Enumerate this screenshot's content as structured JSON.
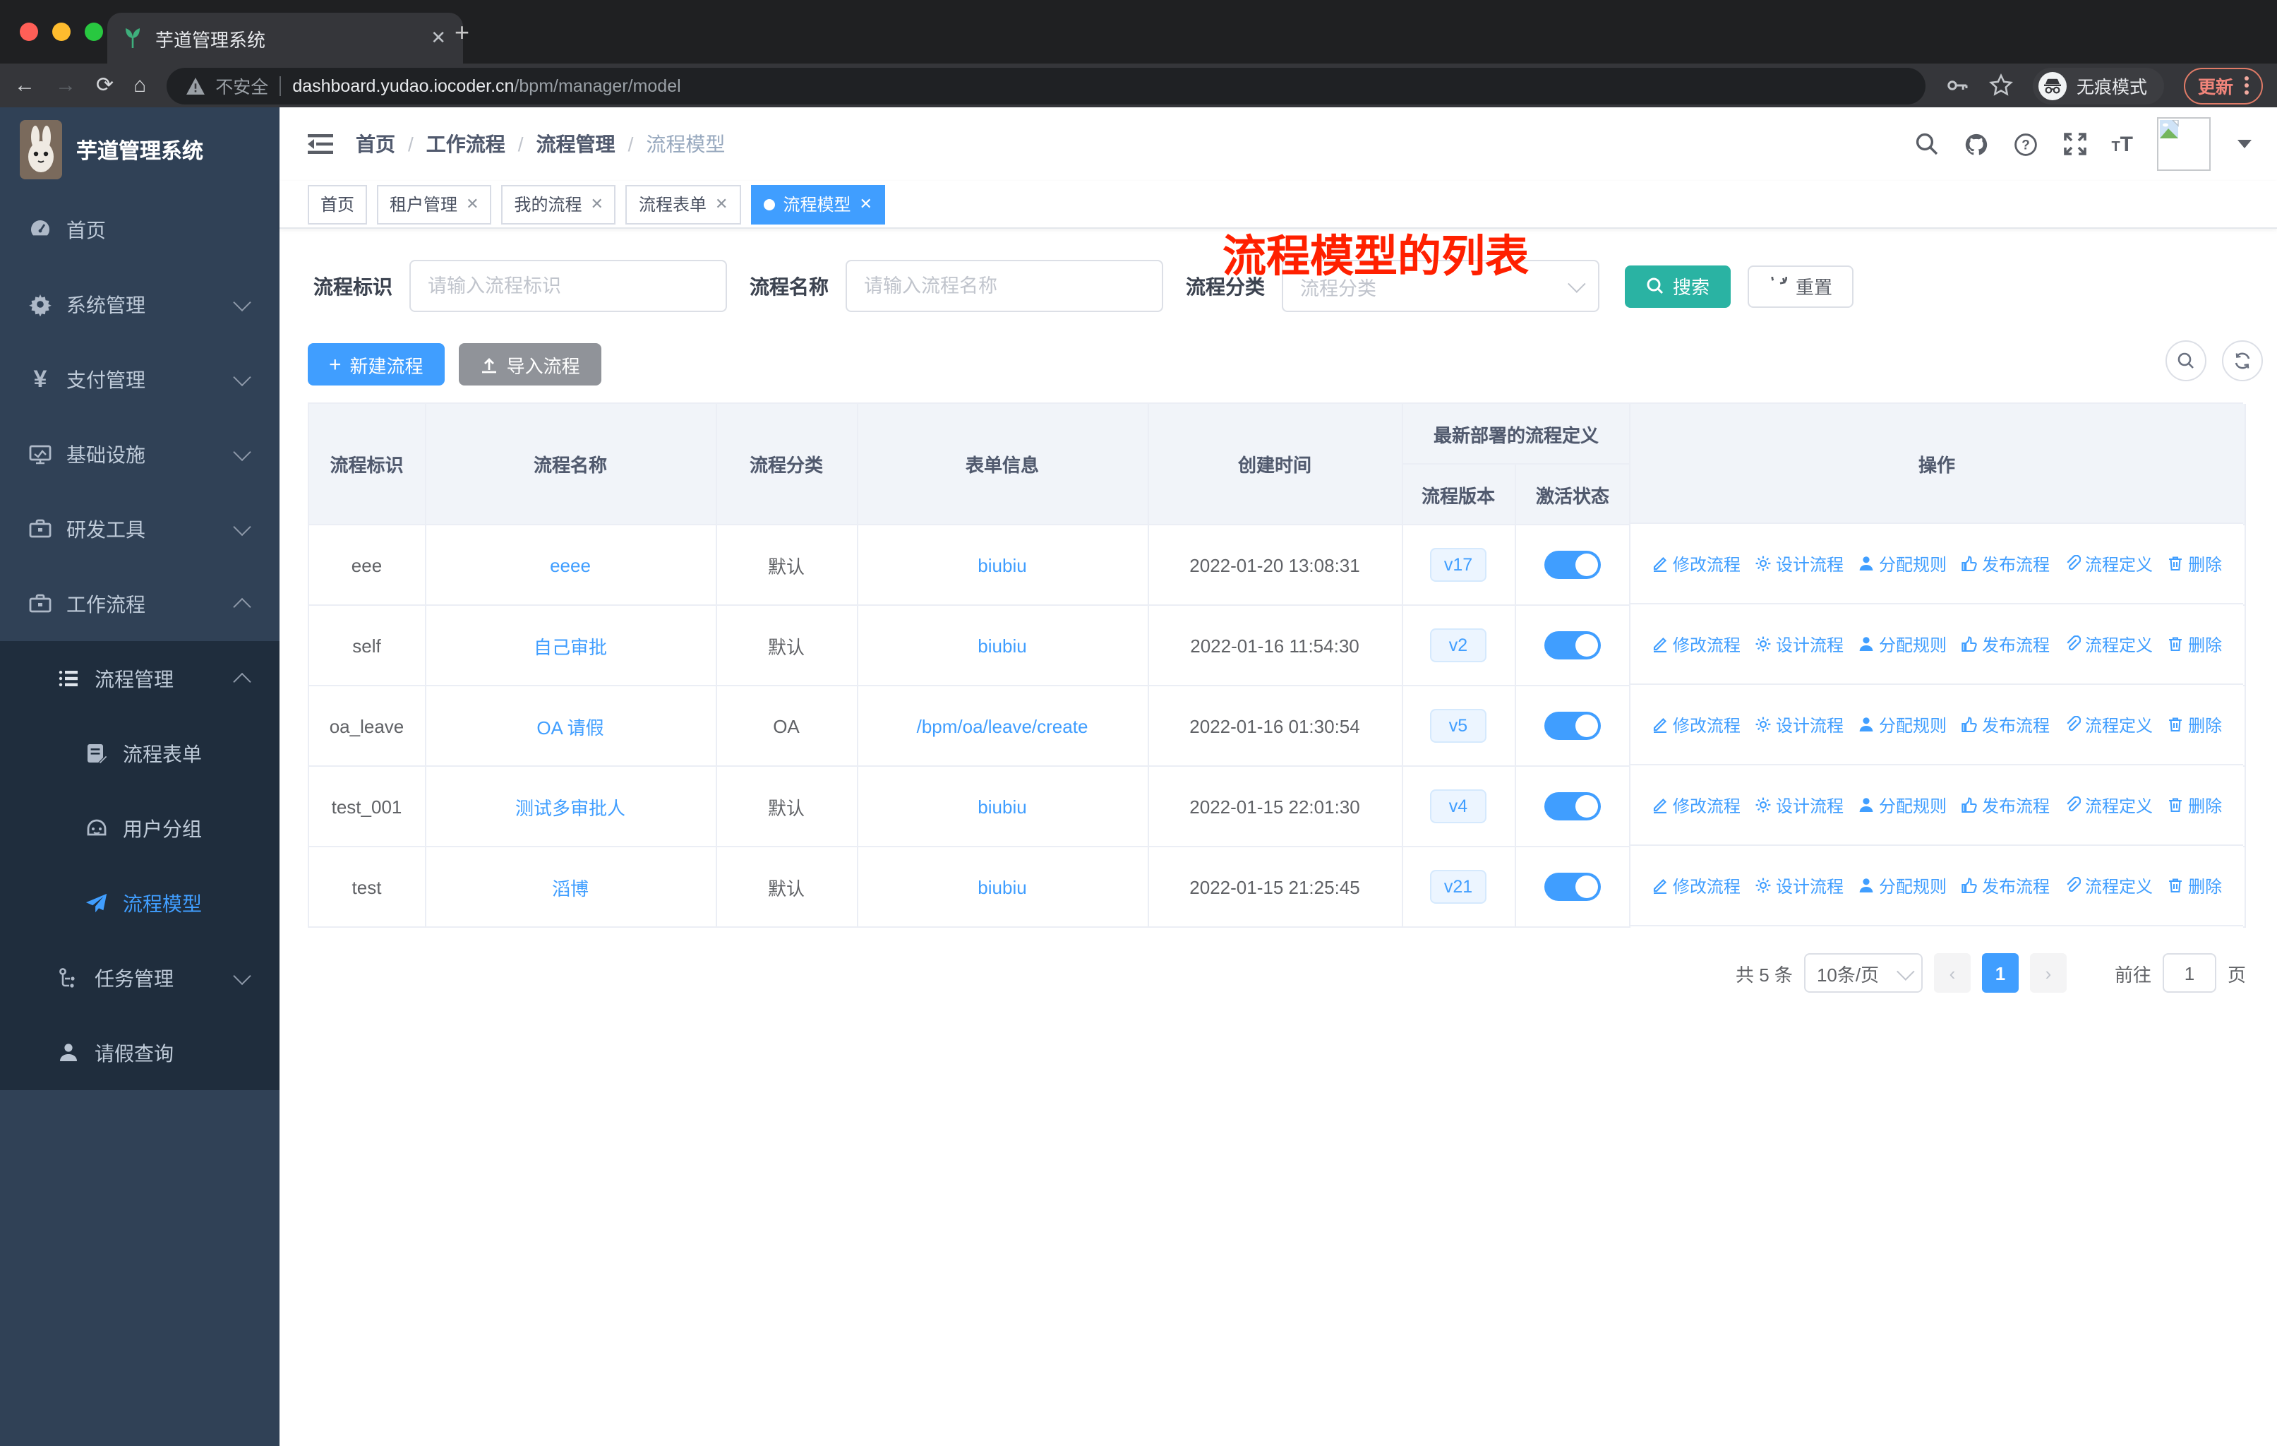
{
  "browser": {
    "tab_title": "芋道管理系统",
    "url_warning": "不安全",
    "url_host": "dashboard.yudao.iocoder.cn",
    "url_path": "/bpm/manager/model",
    "incognito_label": "无痕模式",
    "update_label": "更新"
  },
  "sidebar": {
    "logo_title": "芋道管理系统",
    "items": [
      {
        "label": "首页",
        "icon": "dashboard-icon"
      },
      {
        "label": "系统管理",
        "icon": "gear-icon",
        "arrow": "down"
      },
      {
        "label": "支付管理",
        "icon": "yen-icon",
        "arrow": "down"
      },
      {
        "label": "基础设施",
        "icon": "monitor-icon",
        "arrow": "down"
      },
      {
        "label": "研发工具",
        "icon": "toolbox-icon",
        "arrow": "down"
      },
      {
        "label": "工作流程",
        "icon": "briefcase-icon",
        "arrow": "up"
      },
      {
        "label": "流程管理",
        "icon": "list-icon",
        "arrow": "up"
      },
      {
        "label": "流程表单",
        "icon": "form-icon"
      },
      {
        "label": "用户分组",
        "icon": "robot-icon"
      },
      {
        "label": "流程模型",
        "icon": "paper-plane-icon",
        "active": true
      },
      {
        "label": "任务管理",
        "icon": "tree-icon",
        "arrow": "down"
      },
      {
        "label": "请假查询",
        "icon": "person-icon"
      }
    ]
  },
  "header": {
    "breadcrumb": [
      "首页",
      "工作流程",
      "流程管理",
      "流程模型"
    ],
    "annotation": "流程模型的列表"
  },
  "tags": [
    {
      "label": "首页"
    },
    {
      "label": "租户管理"
    },
    {
      "label": "我的流程"
    },
    {
      "label": "流程表单"
    },
    {
      "label": "流程模型",
      "active": true
    }
  ],
  "filters": {
    "id_label": "流程标识",
    "id_placeholder": "请输入流程标识",
    "name_label": "流程名称",
    "name_placeholder": "请输入流程名称",
    "category_label": "流程分类",
    "category_placeholder": "流程分类",
    "search_label": "搜索",
    "reset_label": "重置"
  },
  "toolbar": {
    "create_label": "新建流程",
    "import_label": "导入流程"
  },
  "table": {
    "headers": {
      "id": "流程标识",
      "name": "流程名称",
      "category": "流程分类",
      "form": "表单信息",
      "created": "创建时间",
      "deploy_group": "最新部署的流程定义",
      "version": "流程版本",
      "status": "激活状态",
      "ops": "操作"
    },
    "rows": [
      {
        "id": "eee",
        "name": "eeee",
        "category": "默认",
        "form": "biubiu",
        "created": "2022-01-20 13:08:31",
        "version": "v17",
        "active": true
      },
      {
        "id": "self",
        "name": "自己审批",
        "category": "默认",
        "form": "biubiu",
        "created": "2022-01-16 11:54:30",
        "version": "v2",
        "active": true
      },
      {
        "id": "oa_leave",
        "name": "OA 请假",
        "category": "OA",
        "form": "/bpm/oa/leave/create",
        "created": "2022-01-16 01:30:54",
        "version": "v5",
        "active": true
      },
      {
        "id": "test_001",
        "name": "测试多审批人",
        "category": "默认",
        "form": "biubiu",
        "created": "2022-01-15 22:01:30",
        "version": "v4",
        "active": true
      },
      {
        "id": "test",
        "name": "滔博",
        "category": "默认",
        "form": "biubiu",
        "created": "2022-01-15 21:25:45",
        "version": "v21",
        "active": true
      }
    ],
    "actions": [
      {
        "label": "修改流程",
        "icon": "edit-icon"
      },
      {
        "label": "设计流程",
        "icon": "design-icon"
      },
      {
        "label": "分配规则",
        "icon": "assign-rule-icon"
      },
      {
        "label": "发布流程",
        "icon": "publish-icon"
      },
      {
        "label": "流程定义",
        "icon": "definition-icon"
      },
      {
        "label": "删除",
        "icon": "delete-icon"
      }
    ]
  },
  "pagination": {
    "total": "共 5 条",
    "page_size": "10条/页",
    "page": "1",
    "goto_label": "前往",
    "goto_value": "1",
    "page_suffix": "页"
  },
  "colors": {
    "accent": "#409eff",
    "search_button": "#2ab3a3",
    "annotation": "#ff2000",
    "sidebar_bg": "#304156",
    "submenu_bg": "#1f2d3d",
    "toggle_on": "#409eff",
    "update_badge": "#f0847a",
    "tag_active": "#409eff"
  }
}
